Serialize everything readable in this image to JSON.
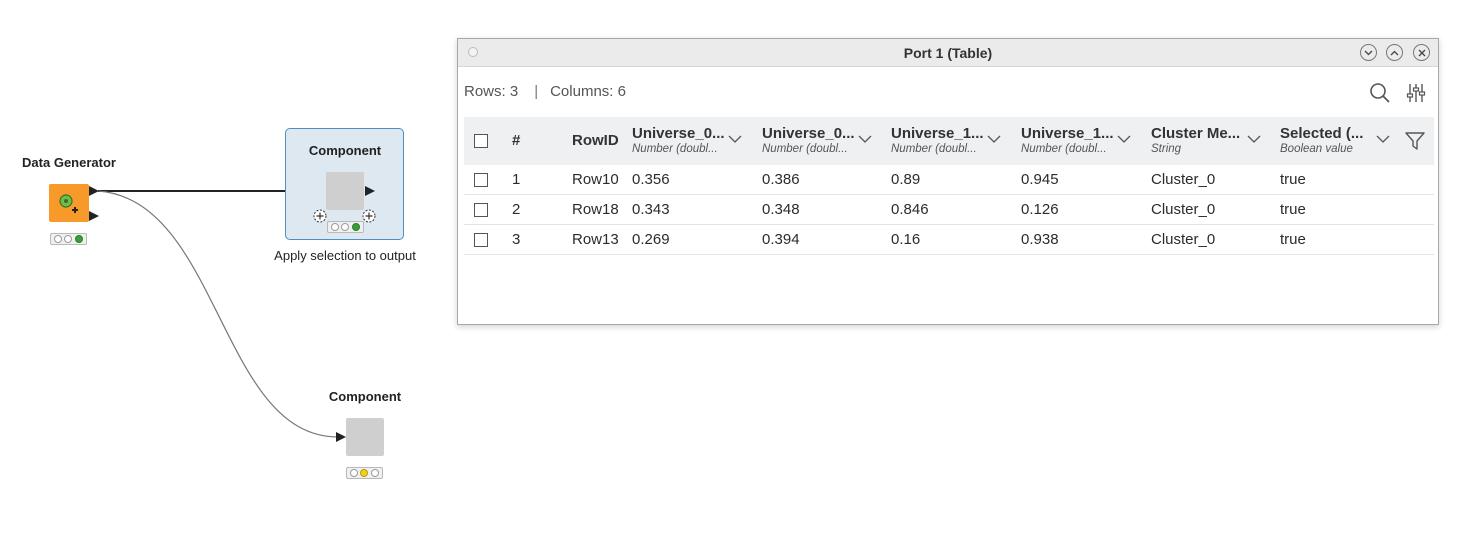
{
  "workflow": {
    "data_generator": {
      "title": "Data Generator",
      "status": "executed"
    },
    "component_top": {
      "title": "Component",
      "label": "Apply selection to output",
      "status": "executed",
      "selected": true
    },
    "component_bottom": {
      "title": "Component",
      "status": "configured"
    }
  },
  "port_view": {
    "window_title": "Port 1 (Table)",
    "rows_label": "Rows: 3",
    "columns_label": "Columns: 6",
    "separator": "|",
    "columns": [
      {
        "name": "Universe_0...",
        "type": "Number (doubl..."
      },
      {
        "name": "Universe_0...",
        "type": "Number (doubl..."
      },
      {
        "name": "Universe_1...",
        "type": "Number (doubl..."
      },
      {
        "name": "Universe_1...",
        "type": "Number (doubl..."
      },
      {
        "name": "Cluster Me...",
        "type": "String"
      },
      {
        "name": "Selected (...",
        "type": "Boolean value"
      }
    ],
    "index_header": "#",
    "rowid_header": "RowID",
    "rows": [
      {
        "index": "1",
        "rowid": "Row10",
        "values": [
          "0.356",
          "0.386",
          "0.89",
          "0.945",
          "Cluster_0",
          "true"
        ]
      },
      {
        "index": "2",
        "rowid": "Row18",
        "values": [
          "0.343",
          "0.348",
          "0.846",
          "0.126",
          "Cluster_0",
          "true"
        ]
      },
      {
        "index": "3",
        "rowid": "Row13",
        "values": [
          "0.269",
          "0.394",
          "0.16",
          "0.938",
          "Cluster_0",
          "true"
        ]
      }
    ],
    "icons": [
      "search-icon",
      "settings-sliders-icon",
      "filter-icon",
      "minimize-icon",
      "maximize-icon",
      "close-icon"
    ]
  },
  "colors": {
    "source_node": "#f79a2a",
    "component_node": "#cfcfcf",
    "selection_fill": "#dde8f1",
    "selection_border": "#4f8fc0",
    "traffic_green": "#3a9d3a",
    "traffic_yellow": "#f2d116"
  }
}
